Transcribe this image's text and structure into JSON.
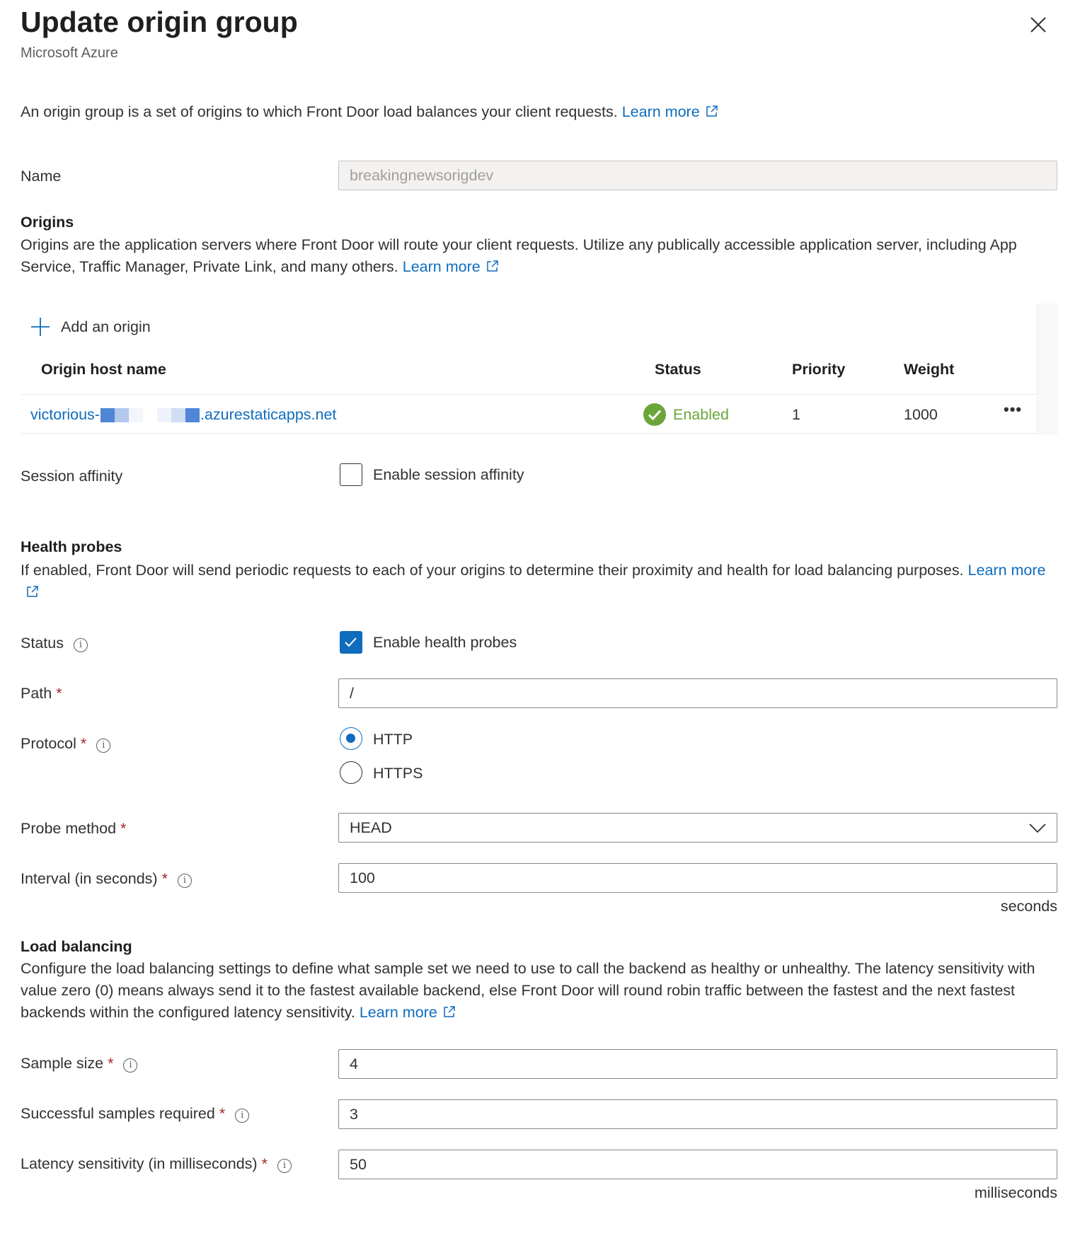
{
  "header": {
    "title": "Update origin group",
    "subtitle": "Microsoft Azure",
    "close_icon": "close-icon"
  },
  "intro": {
    "text": "An origin group is a set of origins to which Front Door load balances your client requests.",
    "learn_more": "Learn more"
  },
  "name": {
    "label": "Name",
    "value": "breakingnewsorigdev"
  },
  "origins": {
    "heading": "Origins",
    "text": "Origins are the application servers where Front Door will route your client requests. Utilize any publically accessible application server, including App Service, Traffic Manager, Private Link, and many others.",
    "learn_more": "Learn more",
    "add_label": "Add an origin",
    "columns": [
      "Origin host name",
      "Status",
      "Priority",
      "Weight"
    ],
    "rows": [
      {
        "host_prefix": "victorious-",
        "host_suffix": ".azurestaticapps.net",
        "status": "Enabled",
        "priority": "1",
        "weight": "1000"
      }
    ]
  },
  "session_affinity": {
    "label": "Session affinity",
    "checkbox_label": "Enable session affinity",
    "checked": false
  },
  "health_probes": {
    "heading": "Health probes",
    "text": "If enabled, Front Door will send periodic requests to each of your origins to determine their proximity and health for load balancing purposes.",
    "learn_more": "Learn more",
    "status_label": "Status",
    "status_checkbox_label": "Enable health probes",
    "status_checked": true,
    "path_label": "Path",
    "path_value": "/",
    "protocol_label": "Protocol",
    "protocol_options": [
      "HTTP",
      "HTTPS"
    ],
    "protocol_selected": "HTTP",
    "method_label": "Probe method",
    "method_value": "HEAD",
    "interval_label": "Interval (in seconds)",
    "interval_value": "100",
    "interval_unit": "seconds"
  },
  "load_balancing": {
    "heading": "Load balancing",
    "text": "Configure the load balancing settings to define what sample set we need to use to call the backend as healthy or unhealthy. The latency sensitivity with value zero (0) means always send it to the fastest available backend, else Front Door will round robin traffic between the fastest and the next fastest backends within the configured latency sensitivity.",
    "learn_more": "Learn more",
    "sample_size_label": "Sample size",
    "sample_size_value": "4",
    "successful_label": "Successful samples required",
    "successful_value": "3",
    "latency_label": "Latency sensitivity (in milliseconds)",
    "latency_value": "50",
    "latency_unit": "milliseconds"
  },
  "required_marker": "*",
  "colors": {
    "accent": "#0f6cbd",
    "enabled_green": "#6ba539",
    "required": "#a4262c"
  }
}
